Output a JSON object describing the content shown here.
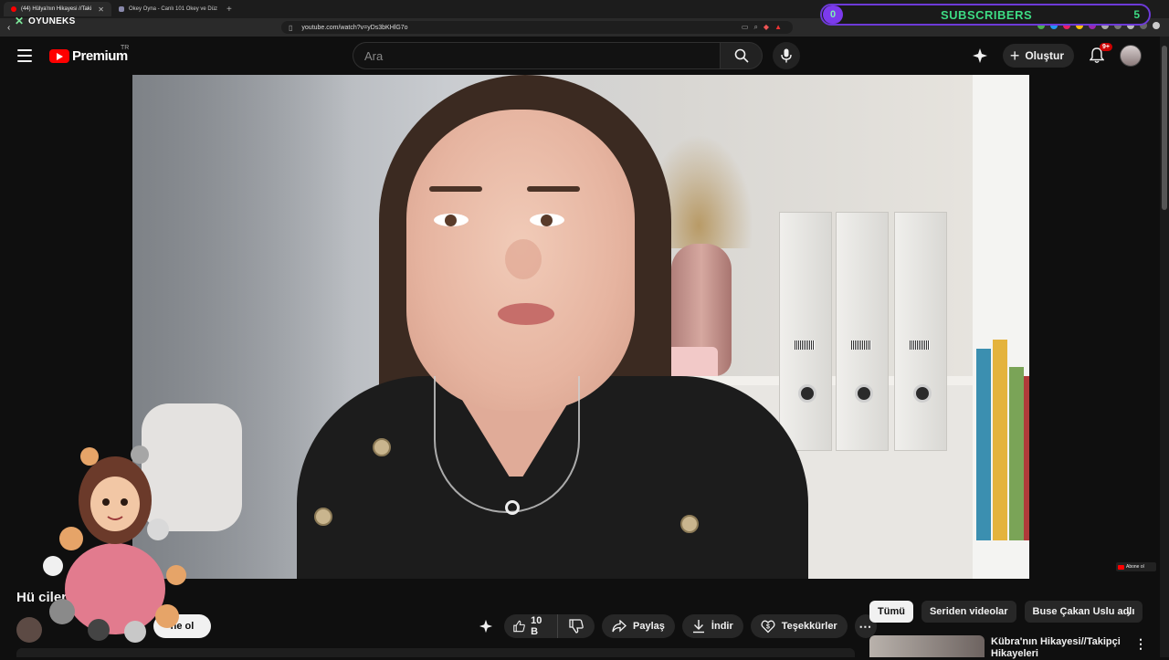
{
  "browser": {
    "tabs": [
      {
        "title": "(44) Hülya'nın Hikayesi //Taki",
        "active": true
      },
      {
        "title": "Okey Oyna - Canlı 101 Okey ve Düz",
        "active": false
      }
    ],
    "url": "youtube.com/watch?v=yDs3bKHlG7o"
  },
  "overlay": {
    "logo_text": "OYUNEKS",
    "subscriber_widget": {
      "label": "SUBSCRIBERS",
      "left_count": "0",
      "right_count": "5"
    }
  },
  "header": {
    "brand": "Premium",
    "region": "TR",
    "search_placeholder": "Ara",
    "create_label": "Oluştur",
    "notification_count": "9+"
  },
  "video": {
    "title": "Hü                     cilerimin Hikayeleri",
    "channel_name": "",
    "subscribe_label": "ne ol",
    "watermark_label": "Abone ol"
  },
  "actions": {
    "like_count": "10 B",
    "share_label": "Paylaş",
    "download_label": "İndir",
    "thanks_label": "Teşekkürler"
  },
  "sidebar": {
    "chips": [
      {
        "label": "Tümü",
        "active": true
      },
      {
        "label": "Seriden videolar",
        "active": false
      },
      {
        "label": "Buse Çakan Uslu adlı",
        "active": false
      }
    ],
    "recommended": [
      {
        "title_line1": "Kübra'nın Hikayesi//Takipçi",
        "title_line2": "Hikayeleri"
      }
    ]
  },
  "colors": {
    "brand_red": "#ff0000",
    "subscriber_green": "#3ddc84",
    "widget_purple": "#7c3aed",
    "background": "#0f0f0f"
  }
}
